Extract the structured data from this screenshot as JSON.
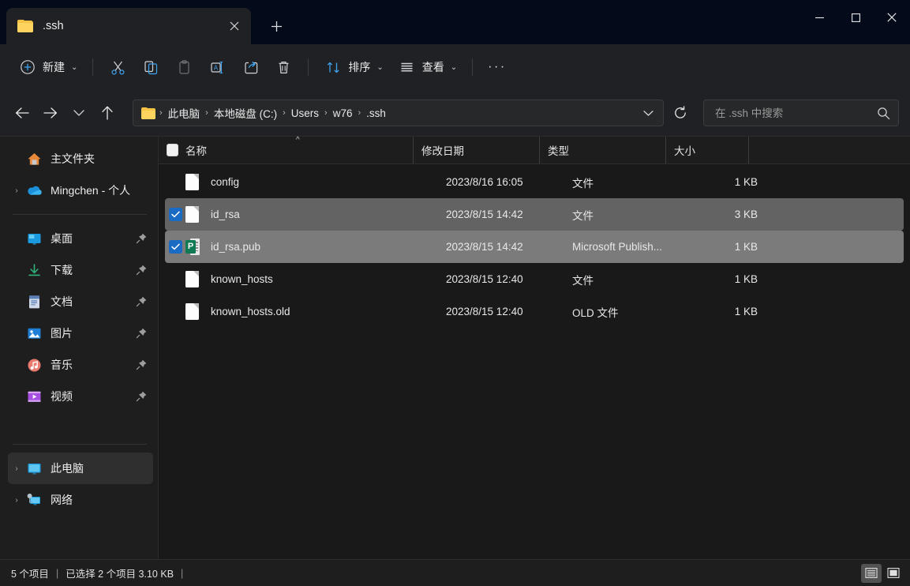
{
  "window": {
    "tab_title": ".ssh",
    "tab_close_label": "✕",
    "new_tab_label": "+",
    "minimize_label": "minimize",
    "maximize_label": "maximize",
    "close_label": "close"
  },
  "toolbar": {
    "new_label": "新建",
    "cut_label": "剪切",
    "copy_label": "复制",
    "paste_label": "粘贴",
    "rename_label": "重命名",
    "share_label": "共享",
    "delete_label": "删除",
    "sort_label": "排序",
    "view_label": "查看",
    "more_label": "···"
  },
  "navbar": {
    "back_label": "后退",
    "forward_label": "前进",
    "recent_label": "最近使用的位置",
    "up_label": "向上",
    "breadcrumbs": [
      {
        "label": "此电脑"
      },
      {
        "label": "本地磁盘 (C:)"
      },
      {
        "label": "Users"
      },
      {
        "label": "w76"
      },
      {
        "label": ".ssh"
      }
    ],
    "separator": "›",
    "dropdown_label": "历史记录",
    "refresh_label": "刷新"
  },
  "search": {
    "placeholder": "在 .ssh 中搜索",
    "value": "",
    "icon": "search-icon"
  },
  "sidebar": {
    "items": [
      {
        "label": "主文件夹",
        "icon": "home-icon",
        "expandable": false,
        "pinned": false,
        "selected": false
      },
      {
        "label": "Mingchen - 个人",
        "icon": "onedrive-icon",
        "expandable": true,
        "pinned": false,
        "selected": false
      }
    ],
    "quick_access": [
      {
        "label": "桌面",
        "icon": "desktop-icon",
        "pinned": true
      },
      {
        "label": "下载",
        "icon": "downloads-icon",
        "pinned": true
      },
      {
        "label": "文档",
        "icon": "documents-icon",
        "pinned": true
      },
      {
        "label": "图片",
        "icon": "pictures-icon",
        "pinned": true
      },
      {
        "label": "音乐",
        "icon": "music-icon",
        "pinned": true
      },
      {
        "label": "视频",
        "icon": "videos-icon",
        "pinned": true
      }
    ],
    "devices": [
      {
        "label": "此电脑",
        "icon": "this-pc-icon",
        "expandable": true,
        "selected": true
      },
      {
        "label": "网络",
        "icon": "network-icon",
        "expandable": true,
        "selected": false
      }
    ]
  },
  "filelist": {
    "columns": {
      "name": "名称",
      "date": "修改日期",
      "type": "类型",
      "size": "大小"
    },
    "sort_indicator": "^",
    "rows": [
      {
        "name": "config",
        "date": "2023/8/16 16:05",
        "type": "文件",
        "size": "1 KB",
        "icon": "generic-file-icon",
        "selected": false,
        "focused": false
      },
      {
        "name": "id_rsa",
        "date": "2023/8/15 14:42",
        "type": "文件",
        "size": "3 KB",
        "icon": "generic-file-icon",
        "selected": true,
        "focused": false
      },
      {
        "name": "id_rsa.pub",
        "date": "2023/8/15 14:42",
        "type": "Microsoft Publish...",
        "size": "1 KB",
        "icon": "publisher-file-icon",
        "selected": true,
        "focused": true
      },
      {
        "name": "known_hosts",
        "date": "2023/8/15 12:40",
        "type": "文件",
        "size": "1 KB",
        "icon": "generic-file-icon",
        "selected": false,
        "focused": false
      },
      {
        "name": "known_hosts.old",
        "date": "2023/8/15 12:40",
        "type": "OLD 文件",
        "size": "1 KB",
        "icon": "generic-file-icon",
        "selected": false,
        "focused": false
      }
    ]
  },
  "status": {
    "item_count": "5 个项目",
    "separator1": "|",
    "selection": "已选择 2 个项目  3.10 KB",
    "separator2": "|",
    "details_view_label": "详细信息",
    "large_icons_view_label": "大图标"
  },
  "colors": {
    "titlebar": "#030a1a",
    "chrome": "#202124",
    "pane": "#191919",
    "accent": "#1a6bc4",
    "selection": "#636363",
    "selection_focus": "#7b7b7b",
    "folder": "#ffd45e"
  }
}
